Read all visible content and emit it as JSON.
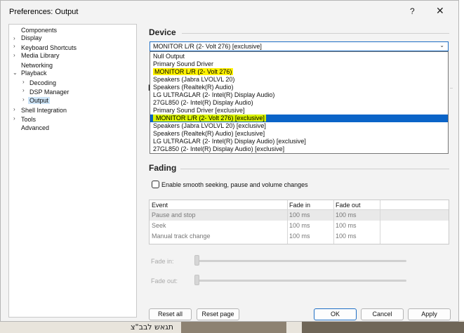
{
  "window": {
    "title": "Preferences: Output",
    "help": "?",
    "close": "✕"
  },
  "tree": [
    {
      "label": "Components"
    },
    {
      "label": "Display"
    },
    {
      "label": "Keyboard Shortcuts"
    },
    {
      "label": "Media Library"
    },
    {
      "label": "Networking"
    },
    {
      "label": "Playback"
    },
    {
      "label": "Decoding"
    },
    {
      "label": "DSP Manager"
    },
    {
      "label": "Output"
    },
    {
      "label": "Shell Integration"
    },
    {
      "label": "Tools"
    },
    {
      "label": "Advanced"
    }
  ],
  "device": {
    "section_title": "Device",
    "selected": "MONITOR L/R (2- Volt 276) [exclusive]",
    "options": [
      "Null Output",
      "Primary Sound Driver",
      "MONITOR L/R (2- Volt 276)",
      "Speakers (Jabra LVOLVL 20)",
      "Speakers (Realtek(R) Audio)",
      "LG ULTRAGLAR (2- Intel(R) Display Audio)",
      "27GL850 (2- Intel(R) Display Audio)",
      "Primary Sound Driver [exclusive]",
      "MONITOR L/R (2- Volt 276) [exclusive]",
      "Speakers (Jabra LVOLVL 20) [exclusive]",
      "Speakers (Realtek(R) Audio) [exclusive]",
      "LG ULTRAGLAR (2- Intel(R) Display Audio) [exclusive]",
      "27GL850 (2- Intel(R) Display Audio) [exclusive]"
    ],
    "hidden_section_letter": "B"
  },
  "fading": {
    "section_title": "Fading",
    "checkbox_label": "Enable smooth seeking, pause and volume changes",
    "columns": [
      "Event",
      "Fade in",
      "Fade out"
    ],
    "rows": [
      {
        "event": "Pause and stop",
        "fade_in": "100 ms",
        "fade_out": "100 ms"
      },
      {
        "event": "Seek",
        "fade_in": "100 ms",
        "fade_out": "100 ms"
      },
      {
        "event": "Manual track change",
        "fade_in": "100 ms",
        "fade_out": "100 ms"
      }
    ],
    "fade_in_label": "Fade in:",
    "fade_out_label": "Fade out:"
  },
  "buttons": {
    "reset_all": "Reset all",
    "reset_page": "Reset page",
    "ok": "OK",
    "cancel": "Cancel",
    "apply": "Apply"
  },
  "background": {
    "text": "תגאש לבב\"צ"
  },
  "colors": {
    "accent": "#1f6fc5",
    "selection": "#0a64c8",
    "highlight_yellow": "#fff200",
    "highlight_green": "#d9f200"
  }
}
